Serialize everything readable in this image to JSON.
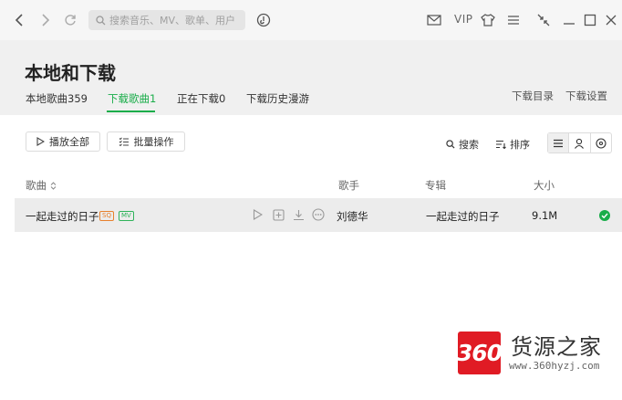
{
  "toolbar": {
    "search_placeholder": "搜索音乐、MV、歌单、用户",
    "vip_label": "VIP"
  },
  "page": {
    "title": "本地和下载",
    "tabs": [
      {
        "label": "本地歌曲359",
        "active": false
      },
      {
        "label": "下载歌曲1",
        "active": true
      },
      {
        "label": "正在下载0",
        "active": false
      },
      {
        "label": "下载历史漫游",
        "active": false
      }
    ],
    "download_dir_label": "下载目录",
    "download_settings_label": "下载设置"
  },
  "actions": {
    "play_all_label": "播放全部",
    "batch_label": "批量操作",
    "search_label": "搜索",
    "sort_label": "排序"
  },
  "table": {
    "headers": {
      "song": "歌曲",
      "artist": "歌手",
      "album": "专辑",
      "size": "大小"
    },
    "rows": [
      {
        "song": "一起走过的日子",
        "badge_sq": "SQ",
        "badge_mv": "MV",
        "artist": "刘德华",
        "album": "一起走过的日子",
        "size": "9.1M",
        "downloaded": true
      }
    ]
  },
  "watermark": {
    "logo_text": "360",
    "site_name": "货源之家",
    "url": "www.360hyzj.com"
  },
  "colors": {
    "accent": "#1aad4a",
    "sq_badge": "#e8812d",
    "mv_badge": "#2fb35a",
    "watermark_red": "#e01b24"
  }
}
